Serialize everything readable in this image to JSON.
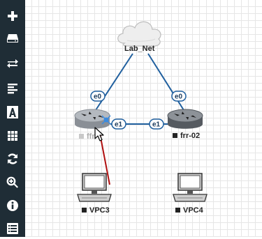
{
  "sidebar": {
    "buttons": [
      {
        "icon": "plus-icon"
      },
      {
        "icon": "storage-drive-icon"
      },
      {
        "icon": "swap-arrows-icon"
      },
      {
        "icon": "align-left-icon"
      },
      {
        "icon": "text-a-icon"
      },
      {
        "icon": "grid-icon"
      },
      {
        "icon": "refresh-icon"
      },
      {
        "icon": "zoom-in-icon"
      },
      {
        "icon": "info-icon"
      },
      {
        "icon": "list-icon"
      }
    ]
  },
  "topology": {
    "network": {
      "label": "Lab_Net"
    },
    "nodes": {
      "frr01": {
        "label": "frr-01",
        "visible_label": "ffr",
        "status_color": "#c8c8c8"
      },
      "frr02": {
        "label": "frr-02",
        "status_color": "#222222"
      },
      "vpc3": {
        "label": "VPC3",
        "status_color": "#222222"
      },
      "vpc4": {
        "label": "VPC4",
        "status_color": "#222222"
      }
    },
    "interfaces": {
      "frr01_to_net": "e0",
      "frr02_to_net": "e0",
      "frr01_to_frr02": "e1",
      "frr02_to_frr01": "e1"
    },
    "colors": {
      "link": "#1f5f9e",
      "pending_link": "#b01010",
      "sidebar_bg": "#1f2d36",
      "icon": "#ffffff"
    }
  }
}
